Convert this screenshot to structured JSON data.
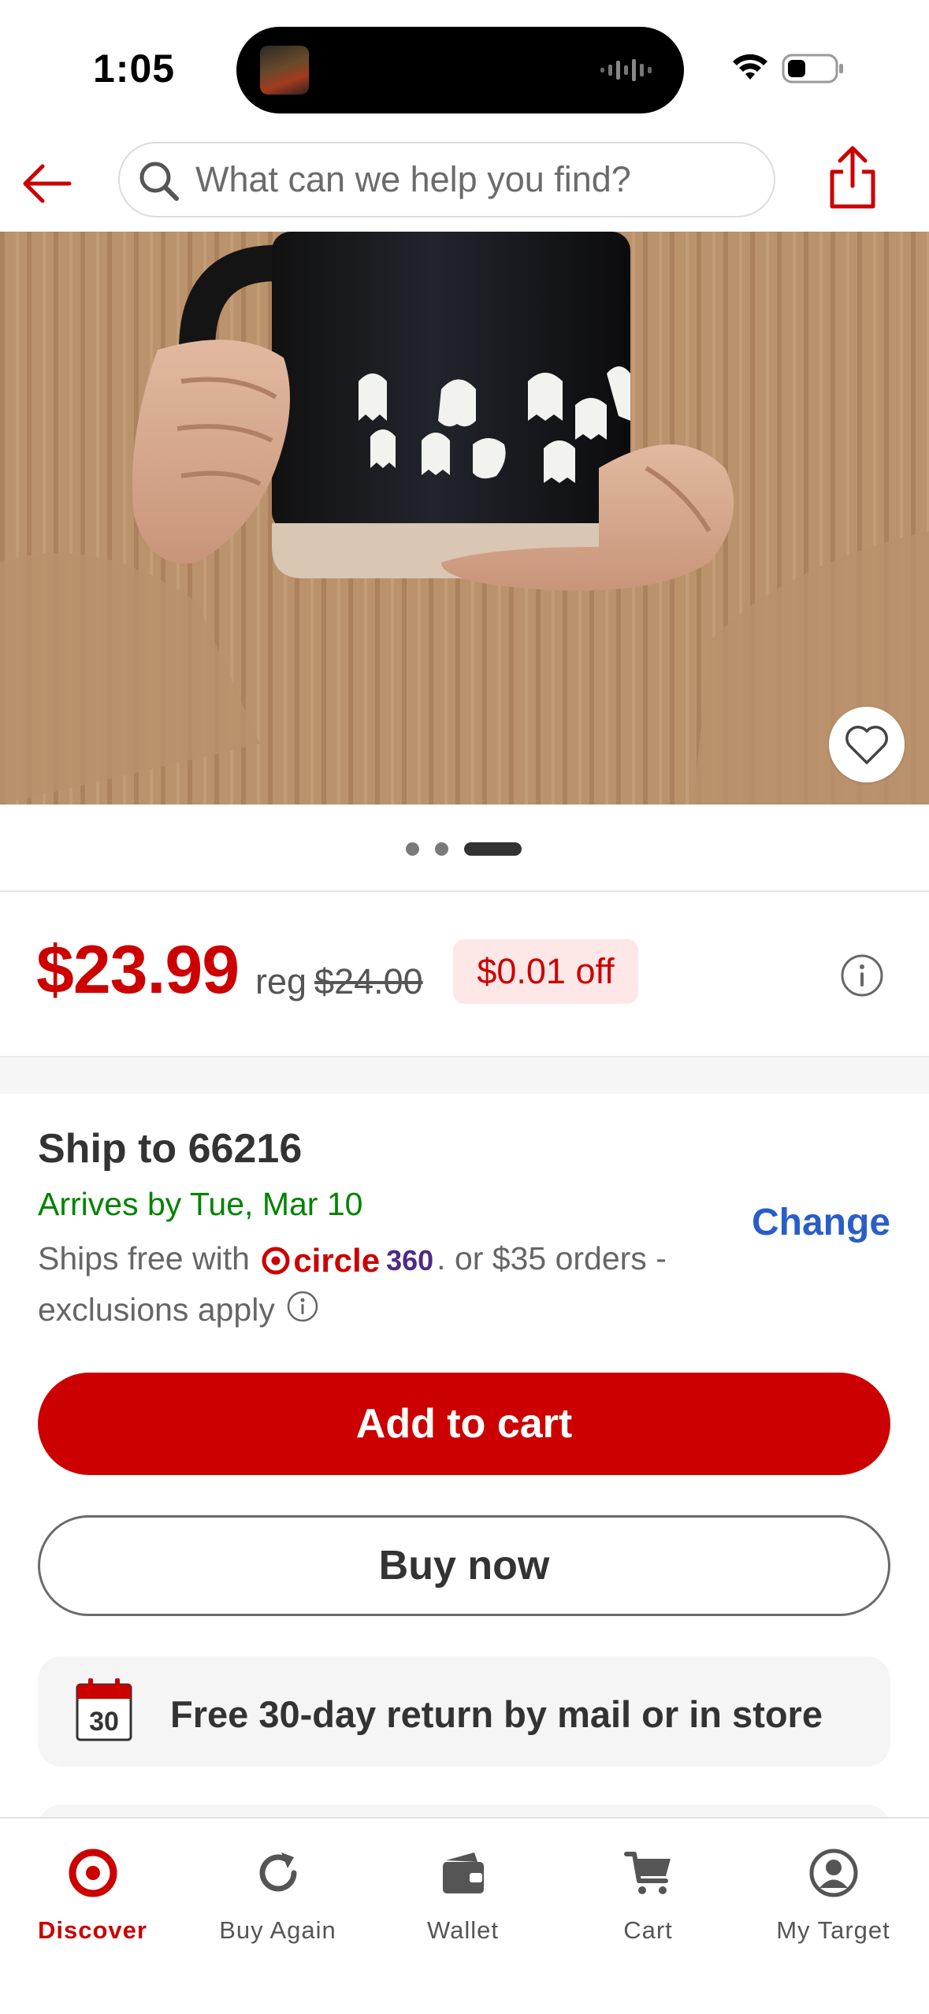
{
  "status_bar": {
    "time": "1:05"
  },
  "header": {
    "search_placeholder": "What can we help you find?"
  },
  "product": {
    "price": "$23.99",
    "reg_label": "reg",
    "reg_price": "$24.00",
    "discount": "$0.01 off",
    "carousel": {
      "total": 3,
      "active": 3
    }
  },
  "shipping": {
    "title": "Ship to 66216",
    "arrives": "Arrives by Tue, Mar 10",
    "ships_free_prefix": "Ships free with",
    "circle_word": "circle",
    "circle_tier": "360",
    "ships_free_suffix": ". or $35 orders - exclusions apply",
    "change": "Change"
  },
  "actions": {
    "add_to_cart": "Add to cart",
    "buy_now": "Buy now"
  },
  "returns": {
    "calendar_day": "30",
    "text": "Free 30-day return by mail or in store"
  },
  "nav": [
    {
      "label": "Discover",
      "icon": "bullseye-icon",
      "active": true
    },
    {
      "label": "Buy Again",
      "icon": "refresh-icon",
      "active": false
    },
    {
      "label": "Wallet",
      "icon": "wallet-icon",
      "active": false
    },
    {
      "label": "Cart",
      "icon": "cart-icon",
      "active": false
    },
    {
      "label": "My Target",
      "icon": "account-icon",
      "active": false
    }
  ],
  "colors": {
    "brand_red": "#cc0000",
    "arrive_green": "#008300",
    "link_blue": "#2a5ec7",
    "circle_purple": "#4e2a84"
  }
}
